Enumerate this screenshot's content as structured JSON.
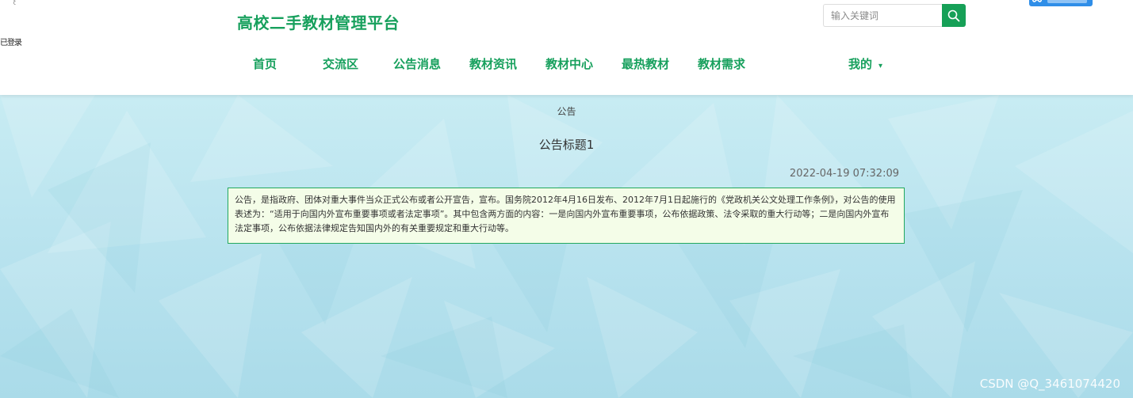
{
  "site": {
    "title": "高校二手教材管理平台"
  },
  "corner_glyph": "꒰",
  "side_text": "已登录",
  "search": {
    "placeholder": "输入关键词"
  },
  "nav": {
    "items": [
      {
        "label": "首页"
      },
      {
        "label": "交流区"
      },
      {
        "label": "公告消息"
      },
      {
        "label": "教材资讯"
      },
      {
        "label": "教材中心"
      },
      {
        "label": "最热教材"
      },
      {
        "label": "教材需求"
      }
    ],
    "my_label": "我的",
    "my_caret": "▾"
  },
  "breadcrumb": "公告",
  "notice": {
    "title": "公告标题1",
    "time": "2022-04-19 07:32:09",
    "content": "公告，是指政府、团体对重大事件当众正式公布或者公开宣告，宣布。国务院2012年4月16日发布、2012年7月1日起施行的《党政机关公文处理工作条例》，对公告的使用表述为：“适用于向国内外宣布重要事项或者法定事项”。其中包含两方面的内容：一是向国内外宣布重要事项，公布依据政策、法令采取的重大行动等；二是向国内外宣布法定事项，公布依据法律规定告知国内外的有关重要规定和重大行动等。"
  },
  "watermark": "CSDN @Q_3461074420",
  "colors": {
    "brand": "#17a05d",
    "notice_bg": "#f4fde8",
    "notice_border": "#23a85e",
    "page_bg": "#b7e2ee"
  },
  "icons": {
    "search": "search-icon",
    "dropdown": "chevron-down-icon"
  }
}
